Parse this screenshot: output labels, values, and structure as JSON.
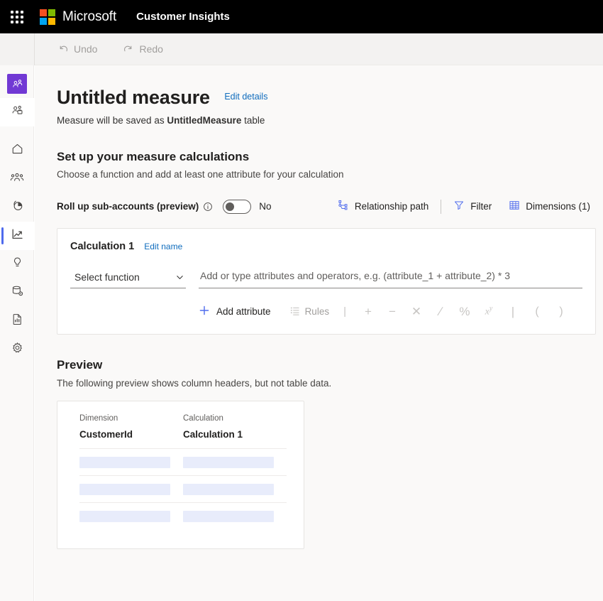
{
  "brandbar": {
    "waffle_icon": "app-launcher-grid-icon",
    "logo_icon": "microsoft-logo-icon",
    "logo_colors": [
      "#f25022",
      "#7fba00",
      "#00a4ef",
      "#ffb900"
    ],
    "company": "Microsoft",
    "app_name": "Customer Insights"
  },
  "commandbar": {
    "menu_icon": "hamburger-menu-icon",
    "undo_label": "Undo",
    "undo_icon": "undo-arrow-icon",
    "redo_label": "Redo",
    "redo_icon": "redo-arrow-icon",
    "disabled_color": "#a19f9d"
  },
  "sidebar": {
    "brand_color": "#7139d4",
    "selected_accent": "#4f6bed",
    "items": [
      {
        "name": "brand-audience",
        "icon": "people-brand-icon",
        "state": "brand"
      },
      {
        "name": "audience-insights",
        "icon": "people-work-icon",
        "state": "sub"
      },
      {
        "name": "home",
        "icon": "home-icon",
        "state": "normal"
      },
      {
        "name": "customers",
        "icon": "people-group-icon",
        "state": "normal"
      },
      {
        "name": "segments",
        "icon": "pie-chart-icon",
        "state": "normal"
      },
      {
        "name": "measures",
        "icon": "trend-chart-icon",
        "state": "selected"
      },
      {
        "name": "intelligence",
        "icon": "lightbulb-icon",
        "state": "normal"
      },
      {
        "name": "data",
        "icon": "database-gear-icon",
        "state": "normal"
      },
      {
        "name": "reports",
        "icon": "report-document-icon",
        "state": "normal"
      },
      {
        "name": "settings",
        "icon": "gear-icon",
        "state": "normal"
      }
    ]
  },
  "page": {
    "title": "Untitled measure",
    "edit_details_label": "Edit details",
    "subtitle_prefix": "Measure will be saved as ",
    "subtitle_table": "UntitledMeasure",
    "subtitle_suffix": " table"
  },
  "setup": {
    "heading": "Set up your measure calculations",
    "description": "Choose a function and add at least one attribute for your calculation",
    "rollup_label": "Roll up sub-accounts (preview)",
    "rollup_info_icon": "info-circle-icon",
    "rollup_toggle_state": "No",
    "rollup_toggle_on": false,
    "tools": [
      {
        "name": "relationship-path",
        "label": "Relationship path",
        "icon": "relationship-path-icon"
      },
      {
        "name": "filter",
        "label": "Filter",
        "icon": "filter-funnel-icon"
      },
      {
        "name": "dimensions",
        "label": "Dimensions (1)",
        "icon": "table-grid-icon"
      }
    ]
  },
  "calculation": {
    "title": "Calculation 1",
    "edit_name_label": "Edit name",
    "function_select_value": "Select function",
    "function_chevron_icon": "chevron-down-icon",
    "expression_placeholder": "Add or type attributes and operators, e.g. (attribute_1 + attribute_2) * 3",
    "expression_value": "",
    "add_attribute_label": "Add attribute",
    "add_attribute_icon": "plus-icon",
    "rules_label": "Rules",
    "rules_icon": "rules-list-icon",
    "operators": [
      {
        "name": "operator-plus",
        "glyph": "+"
      },
      {
        "name": "operator-minus",
        "glyph": "−"
      },
      {
        "name": "operator-multiply",
        "glyph": "✕"
      },
      {
        "name": "operator-divide",
        "glyph": "∕"
      },
      {
        "name": "operator-percent",
        "glyph": "%"
      },
      {
        "name": "operator-power",
        "glyph": "x",
        "sup": "y"
      },
      {
        "name": "operator-pipe",
        "glyph": "|"
      },
      {
        "name": "operator-paren-open",
        "glyph": "("
      },
      {
        "name": "operator-paren-close",
        "glyph": ")"
      }
    ]
  },
  "preview": {
    "heading": "Preview",
    "description": "The following preview shows column headers, but not table data.",
    "columns": [
      {
        "header": "Dimension",
        "name": "CustomerId"
      },
      {
        "header": "Calculation",
        "name": "Calculation 1"
      }
    ],
    "placeholder_rows": 3,
    "placeholder_color": "#e8ecfb"
  }
}
